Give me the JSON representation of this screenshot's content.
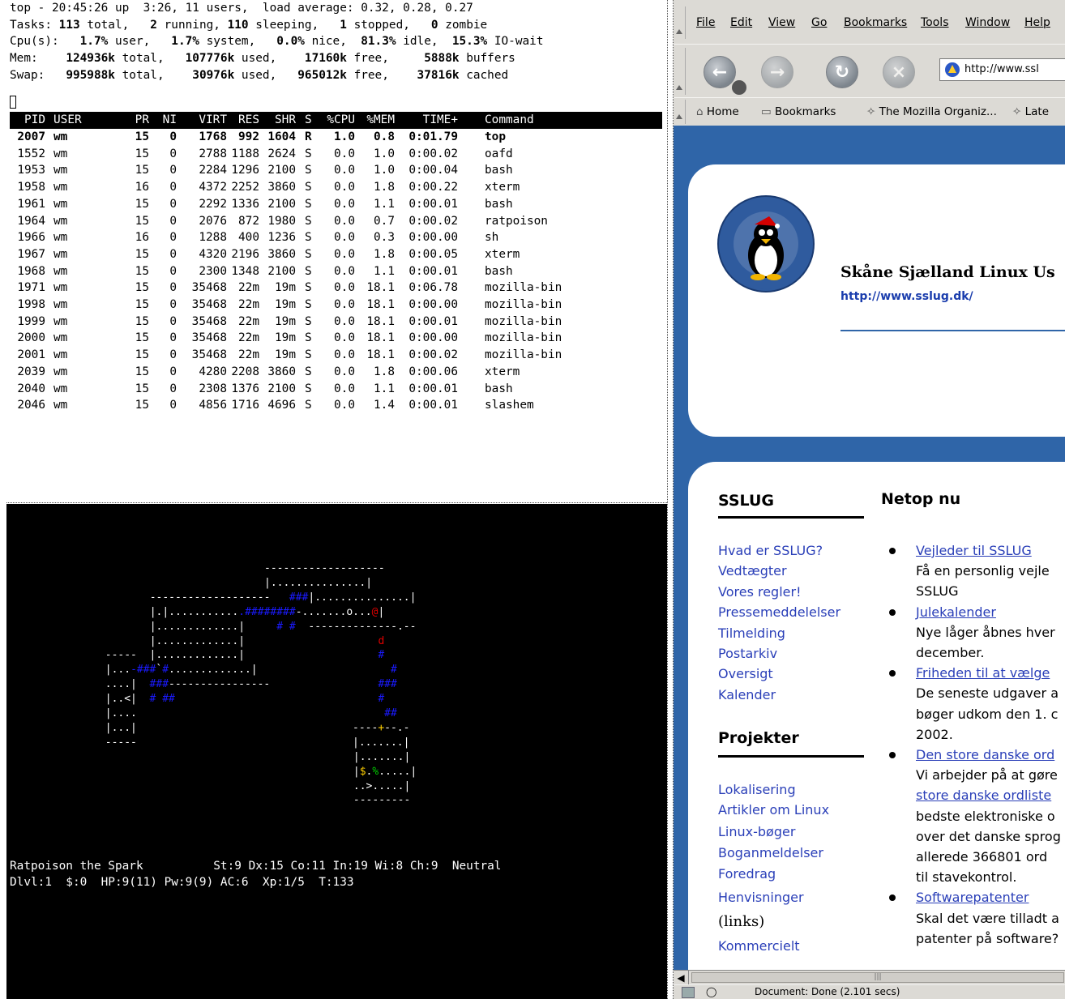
{
  "top_terminal": {
    "summary_lines": [
      [
        [
          "top - 20:45:26 up  3:26, 11 users,  load average: 0.32, 0.28, 0.27",
          false
        ]
      ],
      [
        [
          "Tasks: ",
          false
        ],
        [
          "113",
          true
        ],
        [
          " total,   ",
          false
        ],
        [
          "2",
          true
        ],
        [
          " running, ",
          false
        ],
        [
          "110",
          true
        ],
        [
          " sleeping,   ",
          false
        ],
        [
          "1",
          true
        ],
        [
          " stopped,   ",
          false
        ],
        [
          "0",
          true
        ],
        [
          " zombie",
          false
        ]
      ],
      [
        [
          "Cpu(s):   ",
          false
        ],
        [
          "1.7%",
          true
        ],
        [
          " user,   ",
          false
        ],
        [
          "1.7%",
          true
        ],
        [
          " system,   ",
          false
        ],
        [
          "0.0%",
          true
        ],
        [
          " nice,  ",
          false
        ],
        [
          "81.3%",
          true
        ],
        [
          " idle,  ",
          false
        ],
        [
          "15.3%",
          true
        ],
        [
          " IO-wait",
          false
        ]
      ],
      [
        [
          "Mem:    ",
          false
        ],
        [
          "124936k",
          true
        ],
        [
          " total,   ",
          false
        ],
        [
          "107776k",
          true
        ],
        [
          " used,    ",
          false
        ],
        [
          "17160k",
          true
        ],
        [
          " free,     ",
          false
        ],
        [
          "5888k",
          true
        ],
        [
          " buffers",
          false
        ]
      ],
      [
        [
          "Swap:   ",
          false
        ],
        [
          "995988k",
          true
        ],
        [
          " total,    ",
          false
        ],
        [
          "30976k",
          true
        ],
        [
          " used,   ",
          false
        ],
        [
          "965012k",
          true
        ],
        [
          " free,    ",
          false
        ],
        [
          "37816k",
          true
        ],
        [
          " cached",
          false
        ]
      ]
    ],
    "columns": [
      "PID",
      "USER",
      "PR",
      "NI",
      "VIRT",
      "RES",
      "SHR",
      "S",
      "%CPU",
      "%MEM",
      "TIME+",
      "Command"
    ],
    "processes": [
      [
        "2007",
        "wm",
        "15",
        "0",
        "1768",
        "992",
        "1604",
        "R",
        "1.0",
        "0.8",
        "0:01.79",
        "top"
      ],
      [
        "1552",
        "wm",
        "15",
        "0",
        "2788",
        "1188",
        "2624",
        "S",
        "0.0",
        "1.0",
        "0:00.02",
        "oafd"
      ],
      [
        "1953",
        "wm",
        "15",
        "0",
        "2284",
        "1296",
        "2100",
        "S",
        "0.0",
        "1.0",
        "0:00.04",
        "bash"
      ],
      [
        "1958",
        "wm",
        "16",
        "0",
        "4372",
        "2252",
        "3860",
        "S",
        "0.0",
        "1.8",
        "0:00.22",
        "xterm"
      ],
      [
        "1961",
        "wm",
        "15",
        "0",
        "2292",
        "1336",
        "2100",
        "S",
        "0.0",
        "1.1",
        "0:00.01",
        "bash"
      ],
      [
        "1964",
        "wm",
        "15",
        "0",
        "2076",
        "872",
        "1980",
        "S",
        "0.0",
        "0.7",
        "0:00.02",
        "ratpoison"
      ],
      [
        "1966",
        "wm",
        "16",
        "0",
        "1288",
        "400",
        "1236",
        "S",
        "0.0",
        "0.3",
        "0:00.00",
        "sh"
      ],
      [
        "1967",
        "wm",
        "15",
        "0",
        "4320",
        "2196",
        "3860",
        "S",
        "0.0",
        "1.8",
        "0:00.05",
        "xterm"
      ],
      [
        "1968",
        "wm",
        "15",
        "0",
        "2300",
        "1348",
        "2100",
        "S",
        "0.0",
        "1.1",
        "0:00.01",
        "bash"
      ],
      [
        "1971",
        "wm",
        "15",
        "0",
        "35468",
        "22m",
        "19m",
        "S",
        "0.0",
        "18.1",
        "0:06.78",
        "mozilla-bin"
      ],
      [
        "1998",
        "wm",
        "15",
        "0",
        "35468",
        "22m",
        "19m",
        "S",
        "0.0",
        "18.1",
        "0:00.00",
        "mozilla-bin"
      ],
      [
        "1999",
        "wm",
        "15",
        "0",
        "35468",
        "22m",
        "19m",
        "S",
        "0.0",
        "18.1",
        "0:00.01",
        "mozilla-bin"
      ],
      [
        "2000",
        "wm",
        "15",
        "0",
        "35468",
        "22m",
        "19m",
        "S",
        "0.0",
        "18.1",
        "0:00.00",
        "mozilla-bin"
      ],
      [
        "2001",
        "wm",
        "15",
        "0",
        "35468",
        "22m",
        "19m",
        "S",
        "0.0",
        "18.1",
        "0:00.02",
        "mozilla-bin"
      ],
      [
        "2039",
        "wm",
        "15",
        "0",
        "4280",
        "2208",
        "3860",
        "S",
        "0.0",
        "1.8",
        "0:00.06",
        "xterm"
      ],
      [
        "2040",
        "wm",
        "15",
        "0",
        "2308",
        "1376",
        "2100",
        "S",
        "0.0",
        "1.1",
        "0:00.01",
        "bash"
      ],
      [
        "2046",
        "wm",
        "15",
        "0",
        "4856",
        "1716",
        "4696",
        "S",
        "0.0",
        "1.4",
        "0:00.01",
        "slashem"
      ]
    ]
  },
  "game_terminal": {
    "map_lines": [
      {
        "col": 40,
        "runs": [
          [
            "-------------------",
            "w"
          ]
        ]
      },
      {
        "col": 40,
        "runs": [
          [
            "|...............|",
            "w"
          ]
        ]
      },
      {
        "col": 22,
        "runs": [
          [
            "-------------------",
            "w"
          ],
          [
            "   ",
            "w"
          ],
          [
            "###",
            "b"
          ],
          [
            "|...............|",
            "w"
          ]
        ]
      },
      {
        "col": 22,
        "runs": [
          [
            "|.|...........",
            "w"
          ],
          [
            ".########",
            "b"
          ],
          [
            "-.......o...",
            "w"
          ],
          [
            "@",
            "r"
          ],
          [
            "|",
            "w"
          ]
        ]
      },
      {
        "col": 22,
        "runs": [
          [
            "|.............|",
            "w"
          ],
          [
            "     ",
            "w"
          ],
          [
            "# #",
            "b"
          ],
          [
            "  --------------.--",
            "w"
          ]
        ]
      },
      {
        "col": 22,
        "runs": [
          [
            "|.............|",
            "w"
          ],
          [
            "                     ",
            "w"
          ],
          [
            "d",
            "r"
          ]
        ]
      },
      {
        "col": 15,
        "runs": [
          [
            "-----",
            "w"
          ],
          [
            "  ",
            "w"
          ],
          [
            "|.............|",
            "w"
          ],
          [
            "                     ",
            "w"
          ],
          [
            "#",
            "b"
          ]
        ]
      },
      {
        "col": 15,
        "runs": [
          [
            "|...",
            "w"
          ],
          [
            "-###",
            "b"
          ],
          [
            "`",
            "w"
          ],
          [
            "#",
            "b"
          ],
          [
            ".............|",
            "w"
          ],
          [
            "                     ",
            "w"
          ],
          [
            "#",
            "b"
          ]
        ]
      },
      {
        "col": 15,
        "runs": [
          [
            "....|",
            "w"
          ],
          [
            "  ",
            "w"
          ],
          [
            "###",
            "b"
          ],
          [
            "----------------",
            "w"
          ],
          [
            "                 ",
            "w"
          ],
          [
            "###",
            "b"
          ]
        ]
      },
      {
        "col": 15,
        "runs": [
          [
            "|..<|",
            "w"
          ],
          [
            "  ",
            "w"
          ],
          [
            "# ##",
            "b"
          ],
          [
            "                                ",
            "w"
          ],
          [
            "#",
            "b"
          ]
        ]
      },
      {
        "col": 15,
        "runs": [
          [
            "|....",
            "w"
          ],
          [
            "                                       ",
            "w"
          ],
          [
            "##",
            "b"
          ]
        ]
      },
      {
        "col": 15,
        "runs": [
          [
            "|...|",
            "w"
          ],
          [
            "                                  ",
            "w"
          ],
          [
            "----",
            "w"
          ],
          [
            "+",
            "y"
          ],
          [
            "--.-",
            "w"
          ]
        ]
      },
      {
        "col": 15,
        "runs": [
          [
            "-----",
            "w"
          ],
          [
            "                                  ",
            "w"
          ],
          [
            "|.......|",
            "w"
          ]
        ]
      },
      {
        "col": 54,
        "runs": [
          [
            "|.......|",
            "w"
          ]
        ]
      },
      {
        "col": 54,
        "runs": [
          [
            "|",
            "w"
          ],
          [
            "$",
            "y"
          ],
          [
            ".",
            "w"
          ],
          [
            "%",
            "gr"
          ],
          [
            ".....|",
            "w"
          ]
        ]
      },
      {
        "col": 54,
        "runs": [
          [
            "..>.....|",
            "w"
          ]
        ]
      },
      {
        "col": 54,
        "runs": [
          [
            "---------",
            "w"
          ]
        ]
      }
    ],
    "status_line_1": "Ratpoison the Spark          St:9 Dx:15 Co:11 In:19 Wi:8 Ch:9  Neutral",
    "status_line_2": "Dlvl:1  $:0  HP:9(11) Pw:9(9) AC:6  Xp:1/5  T:133"
  },
  "browser": {
    "menu": [
      "File",
      "Edit",
      "View",
      "Go",
      "Bookmarks",
      "Tools",
      "Window",
      "Help"
    ],
    "url": "http://www.ssl",
    "bookmarks": [
      "Home",
      "Bookmarks",
      "The Mozilla Organiz...",
      "Late"
    ],
    "site_title": "Skåne Sjælland Linux Us",
    "site_url": "http://www.sslug.dk/",
    "sidebar_heading": "SSLUG",
    "sidebar_links": [
      "Hvad er SSLUG?",
      "Vedtægter",
      "Vores regler!",
      "Pressemeddelelser",
      "Tilmelding",
      "Postarkiv",
      "Oversigt",
      "Kalender"
    ],
    "projects_heading": "Projekter",
    "project_links": [
      "Lokalisering",
      "Artikler om Linux",
      "Linux-bøger",
      "Boganmeldelser",
      "Foredrag",
      "Henvisninger",
      "(links)",
      "Kommercielt"
    ],
    "news_heading": "Netop nu",
    "news": [
      {
        "link": "Vejleder til SSLUG",
        "lines": [
          "Få en personlig vejle",
          "SSLUG"
        ]
      },
      {
        "link": "Julekalender",
        "lines": [
          "Nye låger åbnes hver",
          "december."
        ]
      },
      {
        "link": "Friheden til at vælge",
        "lines": [
          "De seneste udgaver a",
          "bøger udkom den 1. c",
          "2002."
        ]
      },
      {
        "link": "Den store danske ord",
        "lines": [
          "Vi arbejder på at gøre",
          "store danske ordliste",
          "bedste elektroniske o",
          "over det danske sprog",
          "allerede 366801 ord",
          "til stavekontrol."
        ]
      },
      {
        "link": "Softwarepatenter",
        "lines": [
          "Skal det være tilladt a",
          "patenter på software?"
        ]
      }
    ],
    "status": "Document: Done (2.101 secs)"
  }
}
